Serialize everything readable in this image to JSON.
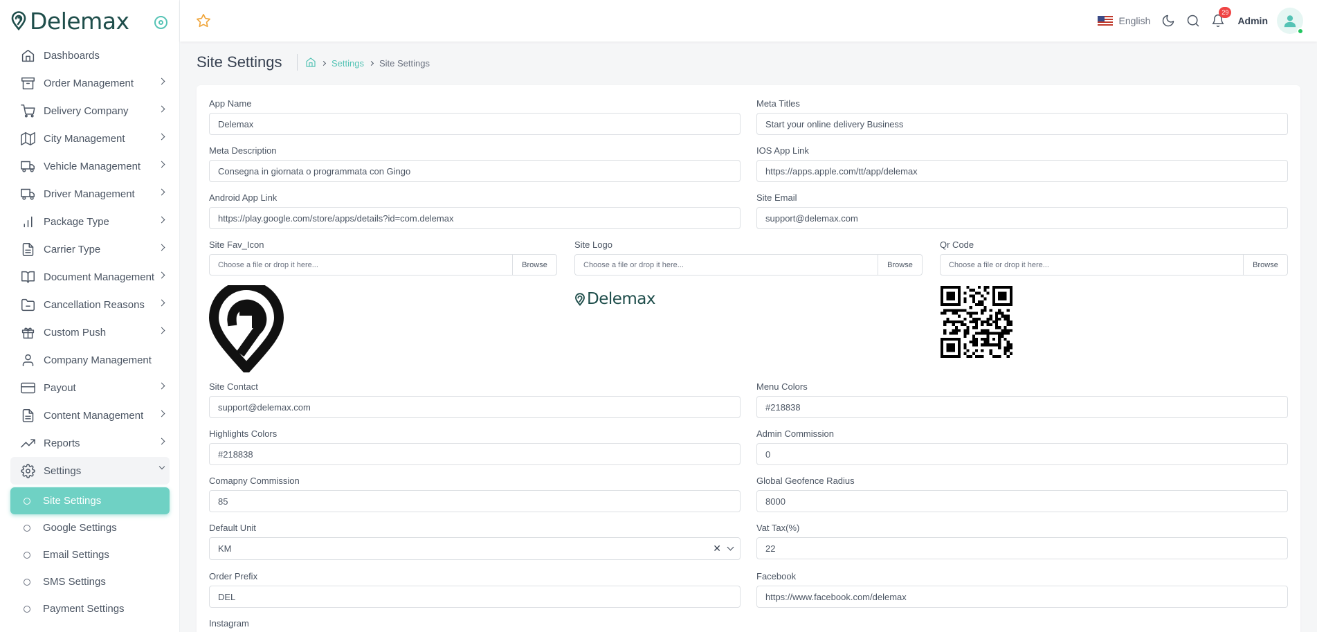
{
  "brand": {
    "name": "Delemax",
    "color": "#1f4e4b",
    "accent": "#55c3b5"
  },
  "sidebar": {
    "items": [
      {
        "label": "Dashboards",
        "icon": "home-icon",
        "has_children": false
      },
      {
        "label": "Order Management",
        "icon": "archive-icon",
        "has_children": true
      },
      {
        "label": "Delivery Company",
        "icon": "cart-icon",
        "has_children": true
      },
      {
        "label": "City Management",
        "icon": "map-icon",
        "has_children": true
      },
      {
        "label": "Vehicle Management",
        "icon": "truck-icon",
        "has_children": true
      },
      {
        "label": "Driver Management",
        "icon": "truck-icon",
        "has_children": true
      },
      {
        "label": "Package Type",
        "icon": "bar-chart-icon",
        "has_children": true
      },
      {
        "label": "Carrier Type",
        "icon": "file-text-icon",
        "has_children": true
      },
      {
        "label": "Document Management",
        "icon": "book-open-icon",
        "has_children": true
      },
      {
        "label": "Cancellation Reasons",
        "icon": "folder-minus-icon",
        "has_children": true
      },
      {
        "label": "Custom Push",
        "icon": "gift-icon",
        "has_children": true
      },
      {
        "label": "Company Management",
        "icon": "user-icon",
        "has_children": false
      },
      {
        "label": "Payout",
        "icon": "credit-card-icon",
        "has_children": true
      },
      {
        "label": "Content Management",
        "icon": "file-text-icon",
        "has_children": true
      },
      {
        "label": "Reports",
        "icon": "trending-up-icon",
        "has_children": true
      },
      {
        "label": "Settings",
        "icon": "gear-icon",
        "has_children": true,
        "open": true
      }
    ],
    "settings_children": [
      {
        "label": "Site Settings",
        "active": true
      },
      {
        "label": "Google Settings"
      },
      {
        "label": "Email Settings"
      },
      {
        "label": "SMS Settings"
      },
      {
        "label": "Payment Settings"
      }
    ]
  },
  "header": {
    "language": "English",
    "notification_count": "29",
    "user_name": "Admin"
  },
  "page": {
    "title": "Site Settings",
    "breadcrumb": {
      "link": "Settings",
      "current": "Site Settings"
    }
  },
  "form": {
    "app_name": {
      "label": "App Name",
      "value": "Delemax"
    },
    "meta_titles": {
      "label": "Meta Titles",
      "value": "Start your online delivery Business"
    },
    "meta_description": {
      "label": "Meta Description",
      "value": "Consegna in giornata o programmata con Gingo"
    },
    "ios_app_link": {
      "label": "IOS App Link",
      "value": "https://apps.apple.com/tt/app/delemax"
    },
    "android_app_link": {
      "label": "Android App Link",
      "value": "https://play.google.com/store/apps/details?id=com.delemax"
    },
    "site_email": {
      "label": "Site Email",
      "value": "support@delemax.com"
    },
    "site_fav_icon": {
      "label": "Site Fav_Icon",
      "placeholder": "Choose a file or drop it here...",
      "button": "Browse"
    },
    "site_logo": {
      "label": "Site Logo",
      "placeholder": "Choose a file or drop it here...",
      "button": "Browse",
      "preview_text": "Delemax"
    },
    "qr_code": {
      "label": "Qr Code",
      "placeholder": "Choose a file or drop it here...",
      "button": "Browse"
    },
    "site_contact": {
      "label": "Site Contact",
      "value": "support@delemax.com"
    },
    "menu_colors": {
      "label": "Menu Colors",
      "value": "#218838"
    },
    "highlights_colors": {
      "label": "Highlights Colors",
      "value": "#218838"
    },
    "admin_commission": {
      "label": "Admin Commission",
      "value": "0"
    },
    "company_commission": {
      "label": "Comapny Commission",
      "value": "85"
    },
    "global_geofence_radius": {
      "label": "Global Geofence Radius",
      "value": "8000"
    },
    "default_unit": {
      "label": "Default Unit",
      "value": "KM"
    },
    "vat_tax": {
      "label": "Vat Tax(%)",
      "value": "22"
    },
    "order_prefix": {
      "label": "Order Prefix",
      "value": "DEL"
    },
    "facebook": {
      "label": "Facebook",
      "value": "https://www.facebook.com/delemax"
    },
    "instagram": {
      "label": "Instagram"
    }
  }
}
